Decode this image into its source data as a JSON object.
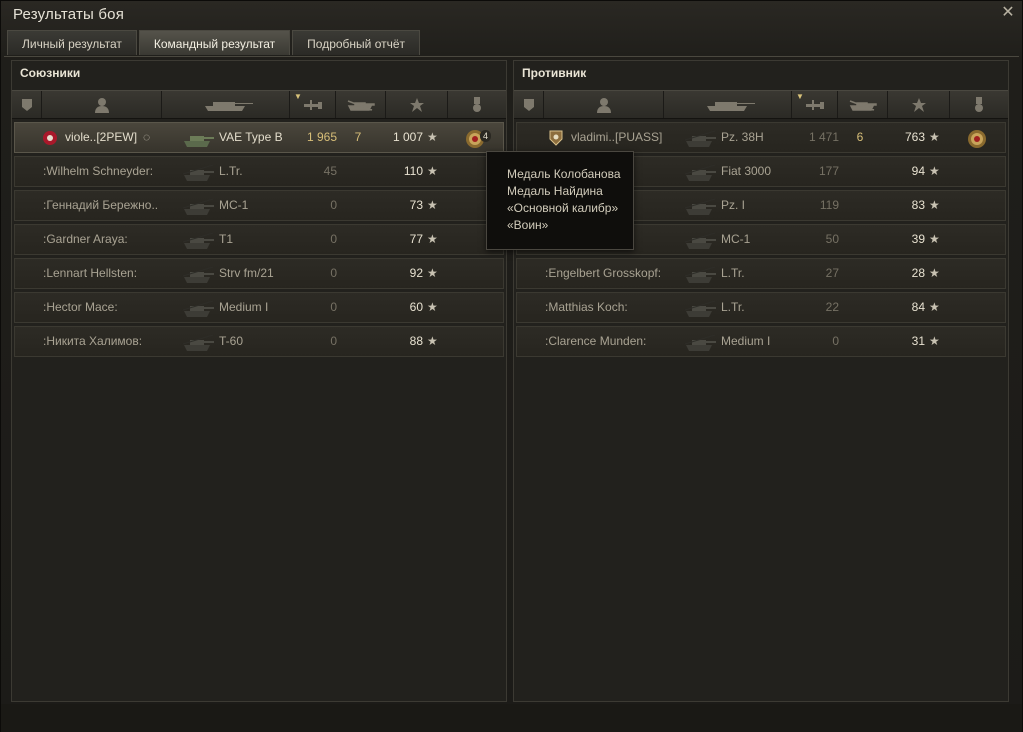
{
  "window": {
    "title": "Результаты боя",
    "close_glyph": "✕"
  },
  "tabs": [
    {
      "label": "Личный результат",
      "active": false
    },
    {
      "label": "Командный результат",
      "active": true
    },
    {
      "label": "Подробный отчёт",
      "active": false
    }
  ],
  "columns": [
    "squad-icon",
    "player-icon",
    "tank-icon",
    "damage-icon",
    "kills-icon",
    "xp-star-icon",
    "medal-icon"
  ],
  "allies": {
    "title": "Союзники",
    "rows": [
      {
        "player": "viole..[2PEW]",
        "tank": "VAE Type B",
        "damage": "1 965",
        "kills": "7",
        "xp": "1 007",
        "self": true,
        "medal_count": "4"
      },
      {
        "player": ":Wilhelm Schneyder:",
        "tank": "L.Tr.",
        "damage": "45",
        "kills": "",
        "xp": "110"
      },
      {
        "player": ":Геннадий Бережно..",
        "tank": "MC-1",
        "damage": "0",
        "kills": "",
        "xp": "73"
      },
      {
        "player": ":Gardner Araya:",
        "tank": "T1",
        "damage": "0",
        "kills": "",
        "xp": "77"
      },
      {
        "player": ":Lennart Hellsten:",
        "tank": "Strv fm/21",
        "damage": "0",
        "kills": "",
        "xp": "92"
      },
      {
        "player": ":Hector Mace:",
        "tank": "Medium I",
        "damage": "0",
        "kills": "",
        "xp": "60"
      },
      {
        "player": ":Никита Халимов:",
        "tank": "T-60",
        "damage": "0",
        "kills": "",
        "xp": "88"
      }
    ]
  },
  "enemies": {
    "title": "Противник",
    "rows": [
      {
        "player": "vladimi..[PUASS]",
        "tank": "Pz. 38H",
        "damage": "1 471",
        "kills": "6",
        "xp": "763",
        "has_medal": true,
        "has_clan": true
      },
      {
        "player": "",
        "tank": "Fiat 3000",
        "damage": "177",
        "kills": "",
        "xp": "94"
      },
      {
        "player": "en:",
        "tank": "Pz. I",
        "damage": "119",
        "kills": "",
        "xp": "83"
      },
      {
        "player": "в:",
        "tank": "MC-1",
        "damage": "50",
        "kills": "",
        "xp": "39"
      },
      {
        "player": ":Engelbert Grosskopf:",
        "tank": "L.Tr.",
        "damage": "27",
        "kills": "",
        "xp": "28"
      },
      {
        "player": ":Matthias Koch:",
        "tank": "L.Tr.",
        "damage": "22",
        "kills": "",
        "xp": "84"
      },
      {
        "player": ":Clarence Munden:",
        "tank": "Medium I",
        "damage": "0",
        "kills": "",
        "xp": "31"
      }
    ]
  },
  "tooltip": {
    "lines": [
      "Медаль Колобанова",
      "Медаль Найдина",
      "«Основной калибр»",
      "«Воин»"
    ]
  },
  "colors": {
    "gold": "#d7be78",
    "accent_red": "#c21a2b",
    "bg": "#1b1a16"
  }
}
